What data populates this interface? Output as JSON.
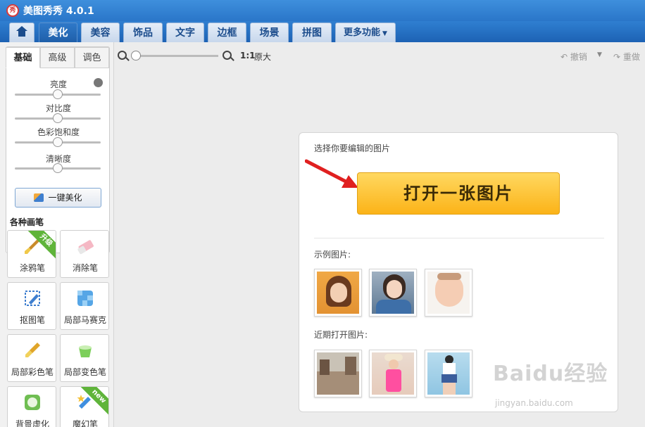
{
  "app": {
    "title": "美图秀秀 4.0.1",
    "logo_text": "秀"
  },
  "nav": {
    "tabs": [
      {
        "label": "美化",
        "active": true
      },
      {
        "label": "美容"
      },
      {
        "label": "饰品"
      },
      {
        "label": "文字"
      },
      {
        "label": "边框"
      },
      {
        "label": "场景"
      },
      {
        "label": "拼图"
      }
    ],
    "more_label": "更多功能"
  },
  "adjust": {
    "subtabs": [
      "基础",
      "高级",
      "调色"
    ],
    "sliders": [
      {
        "label": "亮度",
        "value": 50
      },
      {
        "label": "对比度",
        "value": 50
      },
      {
        "label": "色彩饱和度",
        "value": 50
      },
      {
        "label": "清晰度",
        "value": 50
      }
    ],
    "onekey_label": "一键美化"
  },
  "brushes": {
    "heading": "各种画笔",
    "items": [
      {
        "label": "涂鸦笔",
        "icon": "brush-icon",
        "badge": "升级"
      },
      {
        "label": "消除笔",
        "icon": "eraser-icon",
        "badge": ""
      },
      {
        "label": "抠图笔",
        "icon": "cutout-pen-icon",
        "badge": ""
      },
      {
        "label": "局部马赛克",
        "icon": "mosaic-icon",
        "badge": ""
      },
      {
        "label": "局部彩色笔",
        "icon": "color-brush-icon",
        "badge": ""
      },
      {
        "label": "局部变色笔",
        "icon": "recolor-brush-icon",
        "badge": ""
      },
      {
        "label": "背景虚化",
        "icon": "blur-background-icon",
        "badge": ""
      },
      {
        "label": "魔幻笔",
        "icon": "magic-pen-icon",
        "badge": "new"
      }
    ]
  },
  "toolbar": {
    "zoom_value": 0,
    "ratio_label": "1:1",
    "original_label": "原大",
    "undo_label": "撤销",
    "redo_label": "重做"
  },
  "open_card": {
    "title": "选择你要编辑的图片",
    "open_button_label": "打开一张图片",
    "samples_label": "示例图片:",
    "recent_label": "近期打开图片:"
  },
  "watermark": {
    "text": "Baidu经验",
    "sub": "jingyan.baidu.com"
  },
  "colors": {
    "accent_blue": "#2a76c9",
    "open_button": "#fbb318",
    "arrow_red": "#e02020",
    "badge_green": "#5fb43a"
  }
}
